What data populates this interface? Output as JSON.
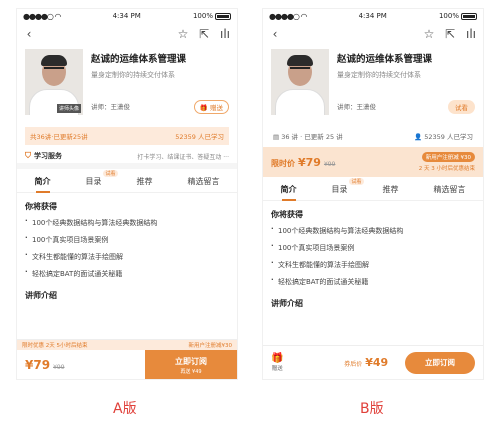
{
  "statusbar": {
    "time": "4:34 PM",
    "battery": "100%"
  },
  "course": {
    "title": "赵诚的运维体系管理课",
    "subtitle": "量身定制你的持续交付体系",
    "teacher": "讲师：王潇俊",
    "photo_tag": "讲师头像"
  },
  "variantA": {
    "gift_label": "🎁 赠送",
    "stats_left": "共36讲·已更新25讲",
    "stats_right": "52359 人已学习",
    "service_title": "学习服务",
    "service_items": "打卡学习、结课证书、答疑互动 ···",
    "tabs": [
      "简介",
      "目录",
      "推荐",
      "精选留言"
    ],
    "tab_badge": "试看",
    "section_title": "你将获得",
    "bullets": [
      "100个经典数据结构与算法经典数据结构",
      "100个真实项目场景案例",
      "文科生都能懂的算法手绘图解",
      "轻松搞定BAT的面试通关秘籍"
    ],
    "intro_title": "讲师介绍",
    "strip_left": "限时优惠 2天 5小时后结束",
    "strip_right": "新用户注册减¥30",
    "price": "¥79",
    "orig_price": "¥99",
    "buy_label": "立即订阅",
    "buy_sub": "再送 ¥49",
    "version_label": "A版"
  },
  "variantB": {
    "trial_label": "试看",
    "stats_left": "36 讲 · 已更新 25 讲",
    "stats_right": "52359 人已学习",
    "promo_label": "限时价",
    "promo_price": "¥79",
    "promo_orig": "¥99",
    "promo_badge": "新用户注册减 ¥30",
    "promo_countdown": "2 天 3 小时后优惠结束",
    "tabs": [
      "简介",
      "目录",
      "推荐",
      "精选留言"
    ],
    "tab_badge": "试看",
    "section_title": "你将获得",
    "bullets": [
      "100个经典数据结构与算法经典数据结构",
      "100个真实项目场景案例",
      "文科生都能懂的算法手绘图解",
      "轻松搞定BAT的面试通关秘籍"
    ],
    "intro_title": "讲师介绍",
    "gift_label": "赠送",
    "final_price_label": "券后价",
    "final_price": "¥49",
    "buy_label": "立即订阅",
    "version_label": "B版"
  },
  "colors": {
    "accent": "#e78a3c",
    "accent_light": "#fdeadb",
    "version_label": "#e0403a"
  }
}
